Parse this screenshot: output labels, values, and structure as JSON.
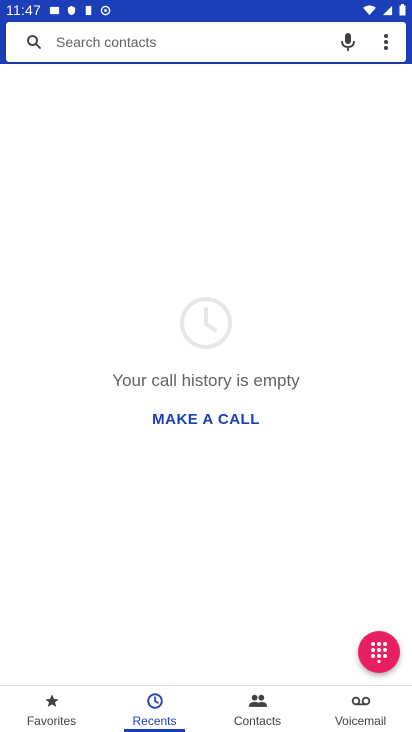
{
  "status_bar": {
    "time": "11:47"
  },
  "search": {
    "placeholder": "Search contacts"
  },
  "empty_state": {
    "message": "Your call history is empty",
    "action_label": "MAKE A CALL"
  },
  "bottom_nav": {
    "items": [
      {
        "label": "Favorites",
        "icon": "star-icon",
        "active": false
      },
      {
        "label": "Recents",
        "icon": "clock-icon",
        "active": true
      },
      {
        "label": "Contacts",
        "icon": "people-icon",
        "active": false
      },
      {
        "label": "Voicemail",
        "icon": "voicemail-icon",
        "active": false
      }
    ]
  },
  "colors": {
    "accent": "#1a3fb9",
    "fab": "#e91e63"
  }
}
